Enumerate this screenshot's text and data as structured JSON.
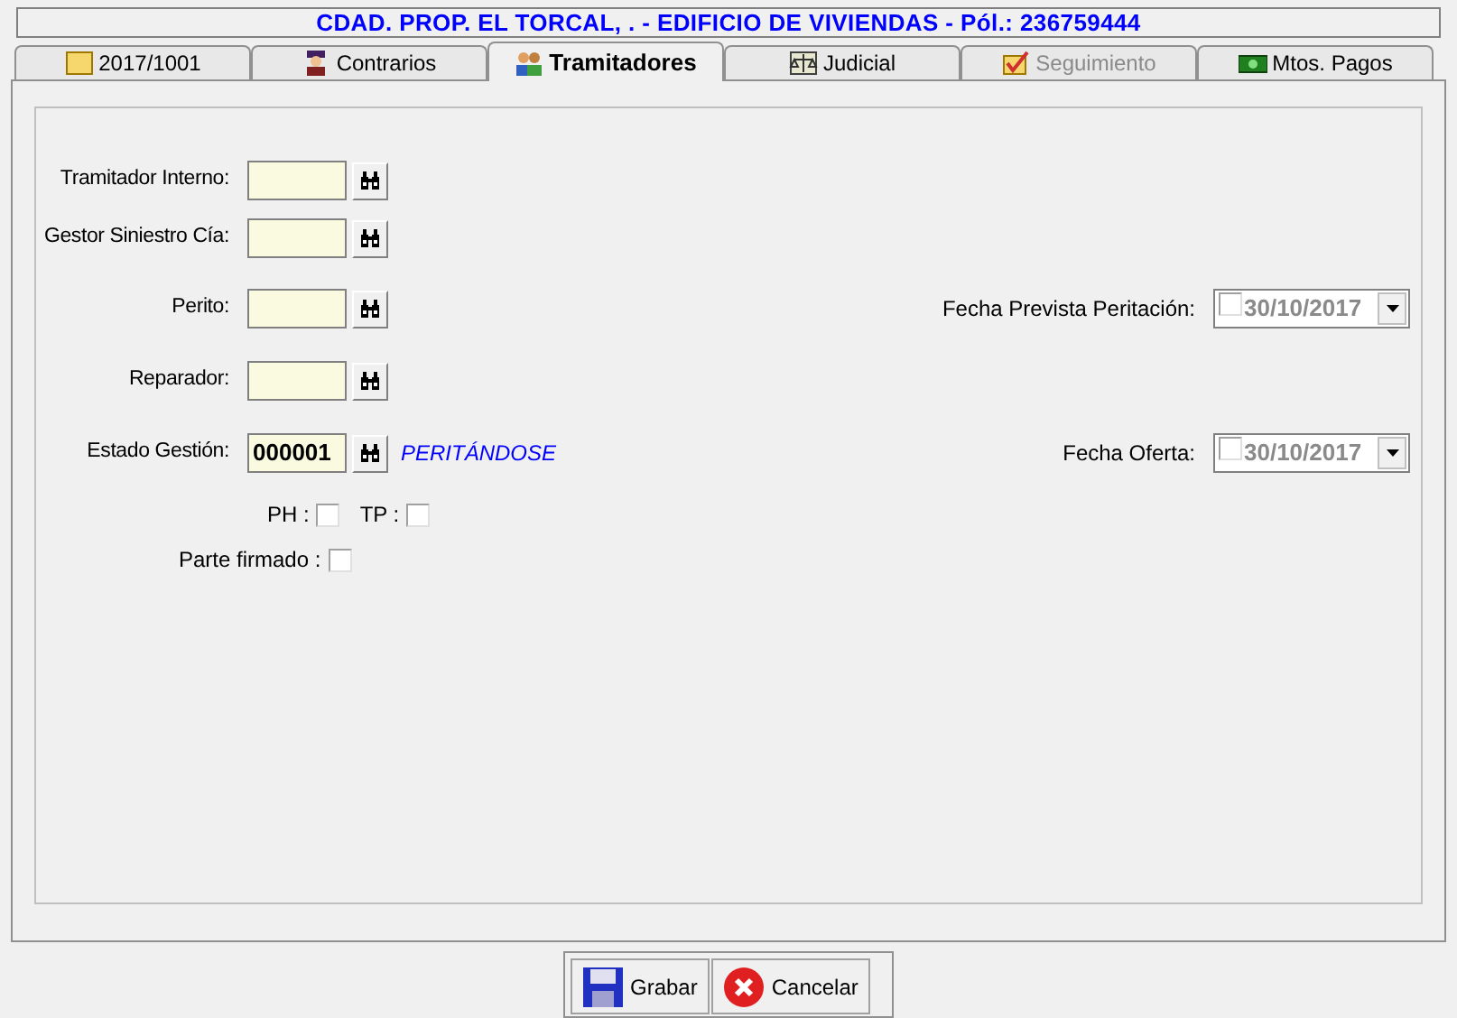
{
  "header": {
    "title": "CDAD. PROP. EL TORCAL, . - EDIFICIO DE VIVIENDAS - Pól.: 236759444"
  },
  "tabs": [
    {
      "label": "2017/1001",
      "selected": false,
      "disabled": false
    },
    {
      "label": "Contrarios",
      "selected": false,
      "disabled": false
    },
    {
      "label": "Tramitadores",
      "selected": true,
      "disabled": false
    },
    {
      "label": "Judicial",
      "selected": false,
      "disabled": false
    },
    {
      "label": "Seguimiento",
      "selected": false,
      "disabled": true
    },
    {
      "label": "Mtos. Pagos",
      "selected": false,
      "disabled": false
    }
  ],
  "fields": [
    {
      "label": "Tramitador Interno:"
    },
    {
      "label": "Gestor Siniestro Cía:"
    },
    {
      "label": "Perito:",
      "date": {
        "label": "Fecha Prevista Peritación:",
        "value": "30/10/2017",
        "checked": false
      }
    },
    {
      "label": "Reparador:"
    },
    {
      "label": "Estado Gestión:",
      "value": "000001",
      "status": "PERITÁNDOSE",
      "date": {
        "label": "Fecha Oferta:",
        "value": "30/10/2017",
        "checked": false
      }
    }
  ],
  "checks": [
    {
      "label": "PH :",
      "checked": false
    },
    {
      "label": "TP :",
      "checked": false
    },
    {
      "label": "Parte firmado :",
      "checked": false
    }
  ],
  "buttons": [
    {
      "label": "Grabar",
      "kind": "save"
    },
    {
      "label": "Cancelar",
      "kind": "cancel"
    }
  ]
}
